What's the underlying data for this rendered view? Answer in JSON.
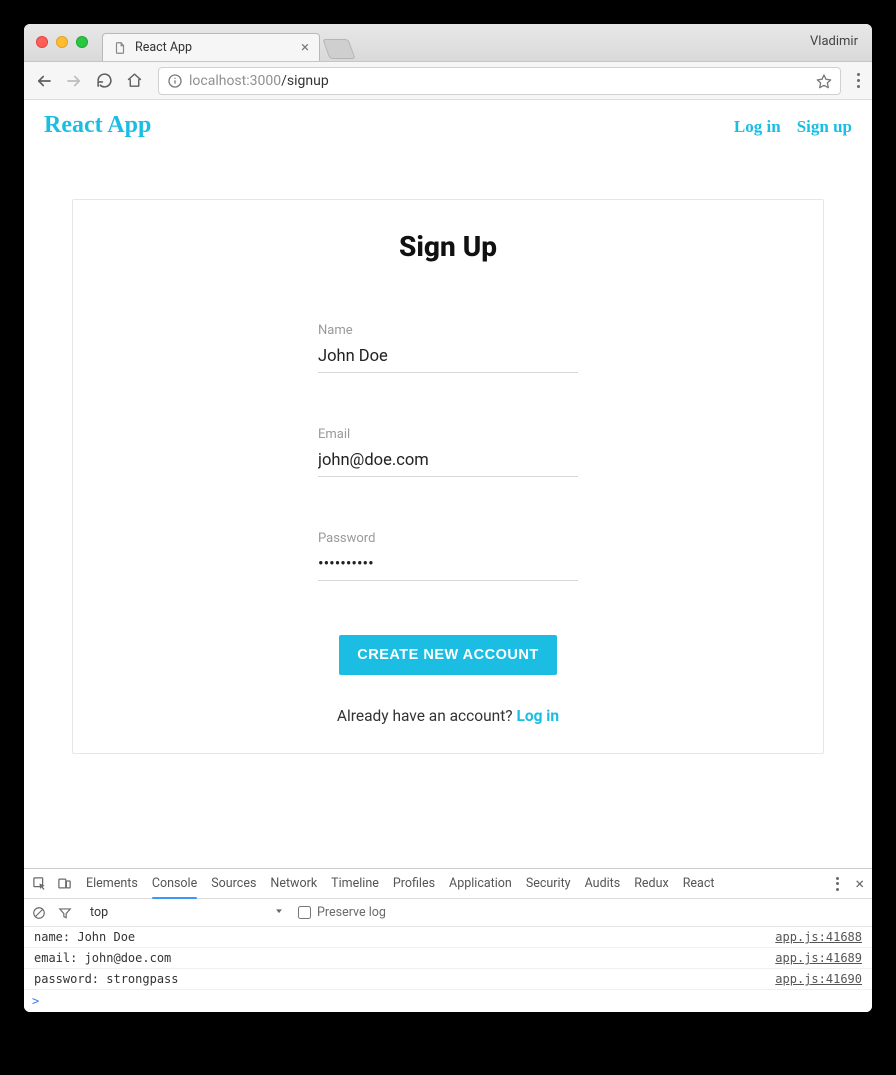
{
  "os": {
    "profile_name": "Vladimir"
  },
  "browser": {
    "tab_title": "React App",
    "url_host": "localhost",
    "url_port": ":3000",
    "url_path": "/signup"
  },
  "header": {
    "app_title": "React App",
    "nav": {
      "login": "Log in",
      "signup": "Sign up"
    }
  },
  "form": {
    "heading": "Sign Up",
    "name_label": "Name",
    "name_value": "John Doe",
    "email_label": "Email",
    "email_value": "john@doe.com",
    "password_label": "Password",
    "password_value": "strongpass",
    "password_mask": "••••••••••",
    "submit_label": "CREATE NEW ACCOUNT",
    "alt_text": "Already have an account? ",
    "alt_link": "Log in"
  },
  "devtools": {
    "tabs": [
      "Elements",
      "Console",
      "Sources",
      "Network",
      "Timeline",
      "Profiles",
      "Application",
      "Security",
      "Audits",
      "Redux",
      "React"
    ],
    "active_tab_index": 1,
    "context": "top",
    "preserve_label": "Preserve log",
    "preserve_checked": false,
    "logs": [
      {
        "msg": "name: John Doe",
        "src": "app.js:41688"
      },
      {
        "msg": "email: john@doe.com",
        "src": "app.js:41689"
      },
      {
        "msg": "password: strongpass",
        "src": "app.js:41690"
      }
    ],
    "prompt": ">"
  }
}
